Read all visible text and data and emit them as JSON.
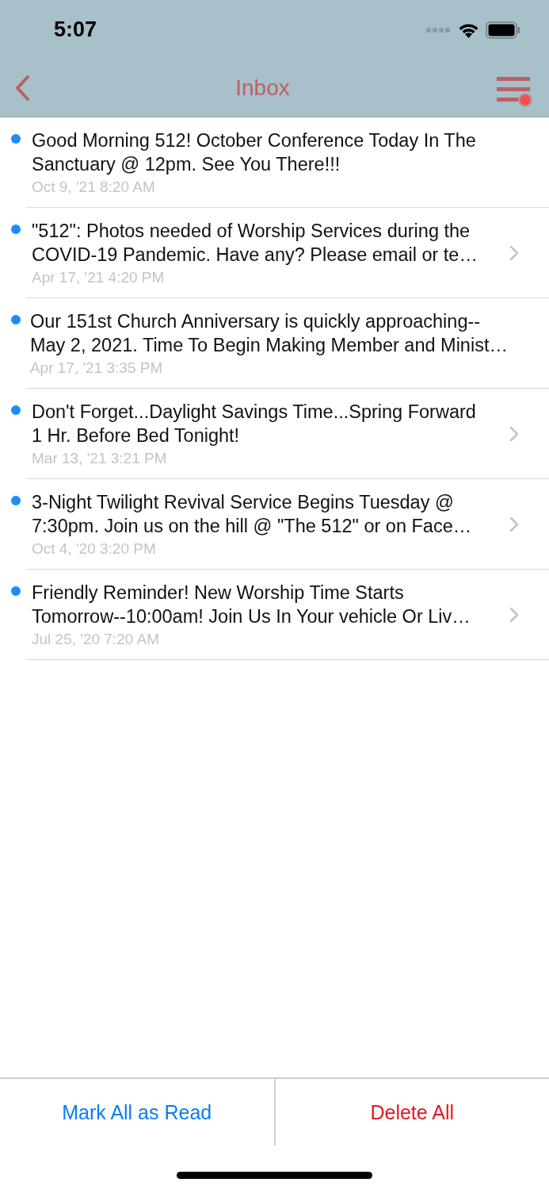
{
  "status_bar": {
    "time": "5:07"
  },
  "nav": {
    "title": "Inbox",
    "menu_badge": true
  },
  "messages": [
    {
      "unread": true,
      "disclosure": false,
      "lines": [
        "Good Morning 512! October Conference Today In The",
        "Sanctuary @ 12pm. See You There!!!"
      ],
      "date": "Oct 9, '21 8:20 AM"
    },
    {
      "unread": true,
      "disclosure": true,
      "lines": [
        "\"512\": Photos needed of Worship Services during the",
        "COVID-19 Pandemic. Have any? Please email or te…"
      ],
      "date": "Apr 17, '21 4:20 PM"
    },
    {
      "unread": true,
      "disclosure": false,
      "lines": [
        "Our 151st Church Anniversary is quickly approaching--",
        "May 2, 2021. Time To Begin Making Member and Minist…"
      ],
      "date": "Apr 17, '21 3:35 PM"
    },
    {
      "unread": true,
      "disclosure": true,
      "lines": [
        "Don't Forget...Daylight Savings Time...Spring Forward",
        "1 Hr. Before Bed Tonight!"
      ],
      "date": "Mar 13, '21 3:21 PM"
    },
    {
      "unread": true,
      "disclosure": true,
      "lines": [
        "3-Night Twilight Revival Service Begins Tuesday @",
        "7:30pm. Join us on the hill @ \"The 512\" or on Face…"
      ],
      "date": "Oct 4, '20 3:20 PM"
    },
    {
      "unread": true,
      "disclosure": true,
      "lines": [
        "Friendly Reminder! New Worship Time Starts",
        "Tomorrow--10:00am! Join Us In Your vehicle Or Liv…"
      ],
      "date": "Jul 25, '20 7:20 AM"
    }
  ],
  "toolbar": [
    {
      "kind": "primary",
      "label": "Mark All as Read"
    },
    {
      "kind": "destructive",
      "label": "Delete All"
    }
  ]
}
